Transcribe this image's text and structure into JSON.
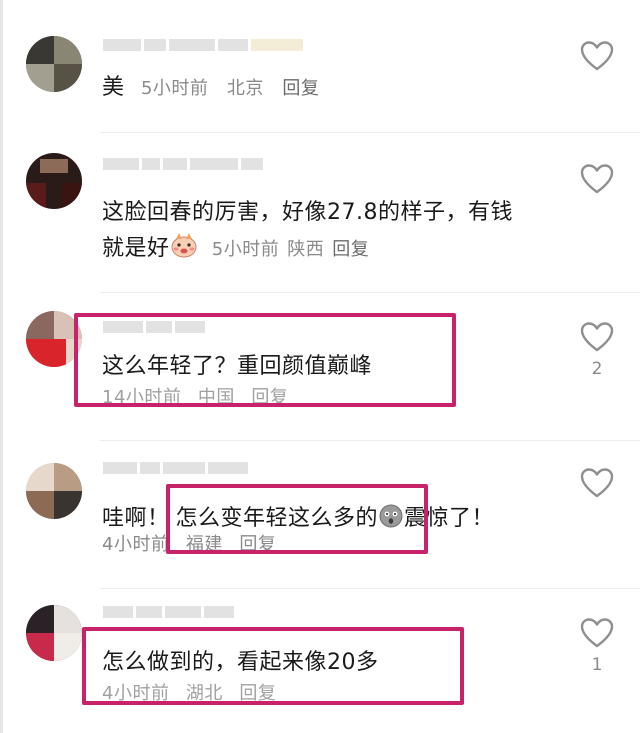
{
  "comments": [
    {
      "text": "美",
      "time": "5小时前",
      "location": "北京",
      "reply": "回复",
      "likes": ""
    },
    {
      "text_line1": "这脸回春的厉害，好像27.8的样子，有钱",
      "text_line2": "就是好",
      "emoji": "blushing-face-emoji",
      "time": "5小时前",
      "location": "陕西",
      "reply": "回复",
      "likes": ""
    },
    {
      "text": "这么年轻了？重回颜值巅峰",
      "time": "14小时前",
      "location": "中国",
      "reply": "回复",
      "likes": "2"
    },
    {
      "text_before": "哇啊！",
      "text_highlight": "怎么变年轻这么多的",
      "emoji": "shocked-face-emoji",
      "text_after": "震惊了！",
      "time": "4小时前",
      "location": "福建",
      "reply": "回复",
      "likes": ""
    },
    {
      "text": "怎么做到的，看起来像20多",
      "time": "4小时前",
      "location": "湖北",
      "reply": "回复",
      "likes": "1"
    }
  ],
  "colors": {
    "highlight_border": "#c8226a",
    "meta_text": "#8a8a8a",
    "body_text": "#1a1a1a"
  },
  "icons": {
    "like": "heart-outline-icon"
  }
}
